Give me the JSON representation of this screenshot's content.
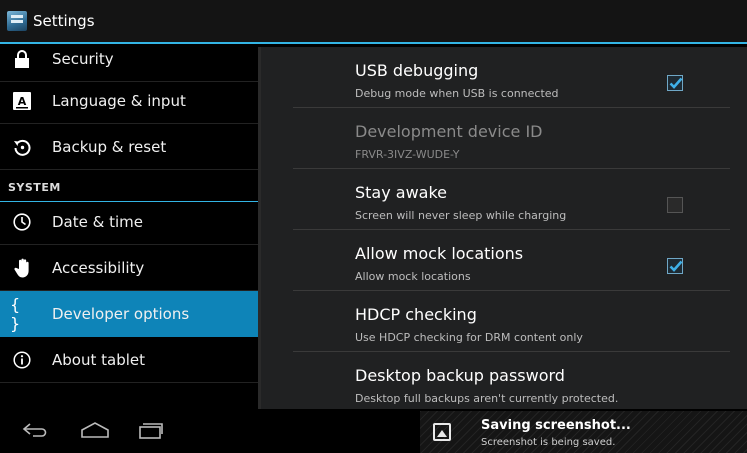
{
  "action_bar": {
    "title": "Settings",
    "app_icon": "settings-app-icon"
  },
  "nav": {
    "items": [
      {
        "label": "Security",
        "icon": "lock-icon"
      },
      {
        "label": "Language & input",
        "icon": "keyboard-icon"
      },
      {
        "label": "Backup & reset",
        "icon": "restore-icon"
      },
      {
        "label": "Date & time",
        "icon": "clock-icon"
      },
      {
        "label": "Accessibility",
        "icon": "hand-icon"
      },
      {
        "label": "Developer options",
        "icon": "braces-icon",
        "selected": true
      },
      {
        "label": "About tablet",
        "icon": "info-icon"
      }
    ],
    "section_header": "SYSTEM"
  },
  "prefs": [
    {
      "title": "USB debugging",
      "summary": "Debug mode when USB is connected",
      "checkbox": true,
      "checked": true,
      "enabled": true
    },
    {
      "title": "Development device ID",
      "summary": "FRVR-3IVZ-WUDE-Y",
      "checkbox": false,
      "enabled": false
    },
    {
      "title": "Stay awake",
      "summary": "Screen will never sleep while charging",
      "checkbox": true,
      "checked": false,
      "enabled": true
    },
    {
      "title": "Allow mock locations",
      "summary": "Allow mock locations",
      "checkbox": true,
      "checked": true,
      "enabled": true
    },
    {
      "title": "HDCP checking",
      "summary": "Use HDCP checking for DRM content only",
      "checkbox": false,
      "enabled": true
    },
    {
      "title": "Desktop backup password",
      "summary": "Desktop full backups aren't currently protected.",
      "checkbox": false,
      "enabled": true
    }
  ],
  "system_bar": {
    "buttons": [
      "back-icon",
      "home-icon",
      "recent-apps-icon"
    ]
  },
  "toast": {
    "title": "Saving screenshot...",
    "subtitle": "Screenshot is being saved.",
    "icon": "image-icon"
  },
  "colors": {
    "accent": "#33b5e5",
    "selected": "#0e84b8",
    "panel": "#202122"
  }
}
